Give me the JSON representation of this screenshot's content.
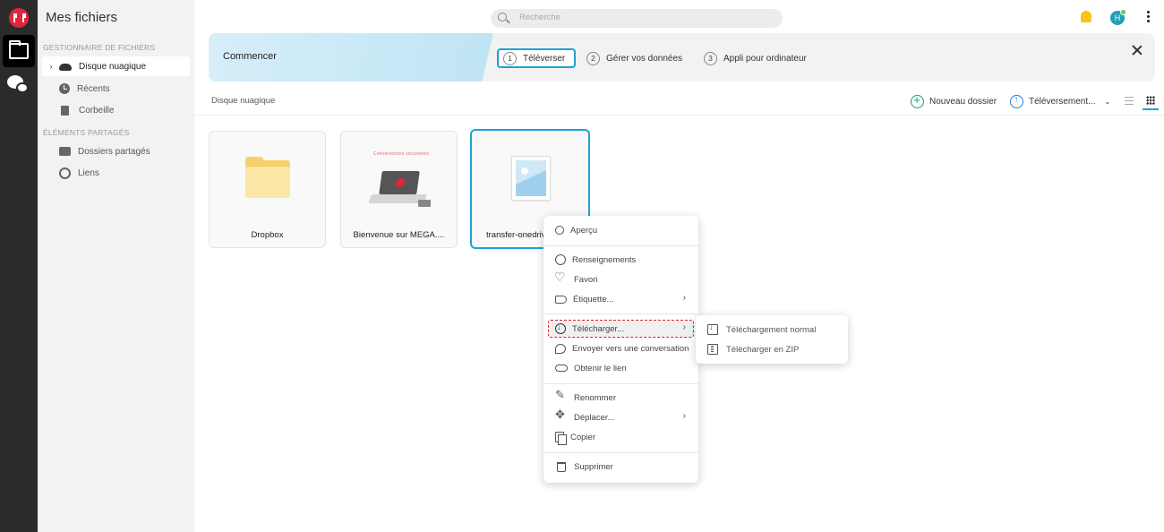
{
  "sidebar": {
    "title": "Mes fichiers",
    "section_files": "GESTIONNAIRE DE FICHIERS",
    "section_shared": "ÉLÉMENTS PARTAGÉS",
    "items": [
      {
        "label": "Disque nuagique",
        "icon": "cloud-icon"
      },
      {
        "label": "Récents",
        "icon": "clock-icon"
      },
      {
        "label": "Corbeille",
        "icon": "trash-icon"
      },
      {
        "label": "Dossiers partagés",
        "icon": "shared-folder-icon"
      },
      {
        "label": "Liens",
        "icon": "link-icon"
      }
    ]
  },
  "topbar": {
    "search_placeholder": "Recherche",
    "avatar_initial": "H"
  },
  "banner": {
    "title": "Commencer",
    "steps": [
      {
        "num": "1",
        "label": "Téléverser"
      },
      {
        "num": "2",
        "label": "Gérer vos données"
      },
      {
        "num": "3",
        "label": "Appli pour ordinateur"
      }
    ]
  },
  "toolbar": {
    "breadcrumb": "Disque nuagique",
    "new_folder": "Nouveau dossier",
    "upload": "Téléversement..."
  },
  "files": [
    {
      "name": "Dropbox",
      "type": "folder"
    },
    {
      "name": "Bienvenue sur MEGA....",
      "type": "image",
      "thumb_caption": "Conversations sécurisées"
    },
    {
      "name": "transfer-onedrive",
      "type": "image"
    }
  ],
  "context_menu": {
    "items": [
      {
        "label": "Aperçu",
        "icon": "search-icon"
      },
      {
        "label": "Renseignements",
        "icon": "info-icon"
      },
      {
        "label": "Favori",
        "icon": "heart-icon"
      },
      {
        "label": "Étiquette...",
        "icon": "tag-icon"
      },
      {
        "label": "Télécharger...",
        "icon": "download-icon"
      },
      {
        "label": "Envoyer vers une conversation",
        "icon": "send-chat-icon"
      },
      {
        "label": "Obtenir le lien",
        "icon": "link-icon"
      },
      {
        "label": "Renommer",
        "icon": "pencil-icon"
      },
      {
        "label": "Déplacer...",
        "icon": "move-icon"
      },
      {
        "label": "Copier",
        "icon": "copy-icon"
      },
      {
        "label": "Supprimer",
        "icon": "trash-icon"
      }
    ],
    "submenu": [
      {
        "label": "Téléchargement normal",
        "icon": "download-file-icon"
      },
      {
        "label": "Télécharger en ZIP",
        "icon": "zip-icon"
      }
    ]
  },
  "colors": {
    "accent": "#1aa3d8",
    "brand": "#e0263a",
    "highlight_outline": "#e02020"
  }
}
